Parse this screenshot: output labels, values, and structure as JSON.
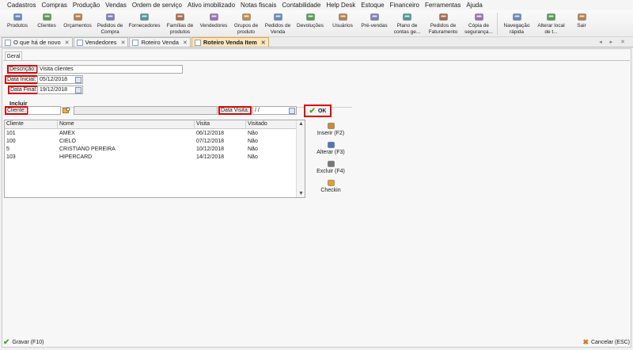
{
  "menu": [
    "Cadastros",
    "Compras",
    "Produção",
    "Vendas",
    "Ordem de serviço",
    "Ativo imobilizado",
    "Notas fiscais",
    "Contabilidade",
    "Help Desk",
    "Estoque",
    "Financeiro",
    "Ferramentas",
    "Ajuda"
  ],
  "toolbar": [
    {
      "label": "Produtos",
      "icon": "box-icon",
      "w": 38
    },
    {
      "label": "Clientes",
      "icon": "people-icon",
      "w": 36
    },
    {
      "label": "Orçamentos",
      "icon": "document-icon",
      "w": 42
    },
    {
      "label": "Pedidos de\nCompra",
      "icon": "cart-icon",
      "w": 40
    },
    {
      "label": "Fornecedores",
      "icon": "truck-icon",
      "w": 47
    },
    {
      "label": "Famílias de\nprodutos",
      "icon": "folder-icon",
      "w": 43
    },
    {
      "label": "Vendedores",
      "icon": "seller-icon",
      "w": 42
    },
    {
      "label": "Grupos de\nproduto",
      "icon": "group-icon",
      "w": 40
    },
    {
      "label": "Pedidos de\nVenda",
      "icon": "order-icon",
      "w": 40
    },
    {
      "label": "Devoluções",
      "icon": "return-icon",
      "w": 42
    },
    {
      "label": "Usuários",
      "icon": "user-icon",
      "w": 40
    },
    {
      "label": "Pré-vendas",
      "icon": "presale-icon",
      "w": 40
    },
    {
      "label": "Plano de\ncontas ge...",
      "icon": "accounts-icon",
      "w": 43
    },
    {
      "label": "Pedidos de\nFaturamento",
      "icon": "billing-icon",
      "w": 48
    },
    {
      "label": "Cópia de\nsegurança...",
      "icon": "backup-icon",
      "w": 42
    },
    {
      "sep": true
    },
    {
      "label": "Navegação\nrápida",
      "icon": "navigate-icon",
      "w": 44
    },
    {
      "label": "Alterar local\nde t...",
      "icon": "location-icon",
      "w": 43
    },
    {
      "label": "Sair",
      "icon": "exit-icon",
      "w": 34
    }
  ],
  "tabs": [
    {
      "label": "O que há de novo",
      "active": false
    },
    {
      "label": "Vendedores",
      "active": false
    },
    {
      "label": "Roteiro Venda",
      "active": false
    },
    {
      "label": "Roteiro Venda Item",
      "active": true
    }
  ],
  "inner_tab": "Geral",
  "form": {
    "descricao_label": "Descrição:",
    "descricao_value": "Visita clientes",
    "data_inicial_label": "Data Inicial:",
    "data_inicial_value": "05/12/2018",
    "data_final_label": "Data Final:",
    "data_final_value": "19/12/2018"
  },
  "incluir": {
    "title": "Incluir",
    "cliente_label": "Cliente:",
    "cliente_value": "",
    "data_visita_label": "Data Visita:",
    "data_visita_value": "/ /",
    "ok_label": "OK"
  },
  "grid": {
    "columns": [
      "Cliente",
      "Nome",
      "Visita",
      "Visitado"
    ],
    "rows": [
      [
        "101",
        "AMEX",
        "06/12/2018",
        "Não"
      ],
      [
        "100",
        "CIELO",
        "07/12/2018",
        "Não"
      ],
      [
        "5",
        "CRISTIANO PEREIRA",
        "10/12/2018",
        "Não"
      ],
      [
        "103",
        "HIPERCARD",
        "14/12/2018",
        "Não"
      ]
    ]
  },
  "side_buttons": [
    {
      "label": "Inserir (F2)",
      "icon": "insert-icon"
    },
    {
      "label": "Alterar (F3)",
      "icon": "edit-icon"
    },
    {
      "label": "Excluir (F4)",
      "icon": "delete-icon"
    },
    {
      "label": "Checkin",
      "icon": "checkin-icon"
    }
  ],
  "footer": {
    "save_label": "Gravar (F10)",
    "cancel_label": "Cancelar (ESC)"
  }
}
